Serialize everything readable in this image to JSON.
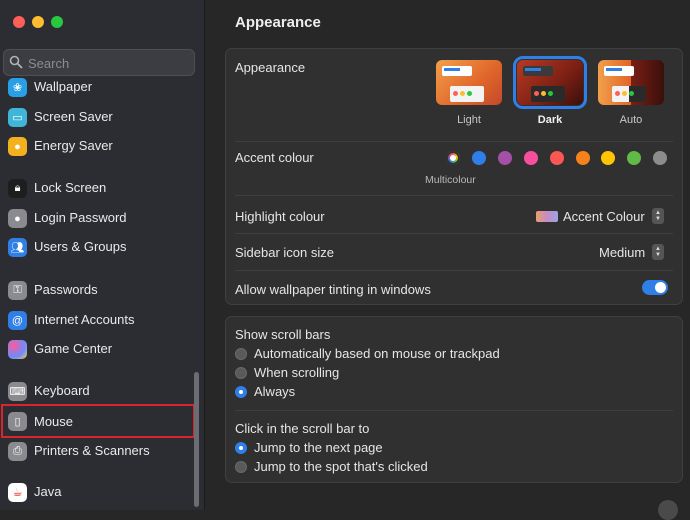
{
  "sidebar": {
    "search_placeholder": "Search",
    "items": [
      {
        "label": "Wallpaper",
        "icon": "wallpaper-icon",
        "color": "#29a0e6"
      },
      {
        "label": "Screen Saver",
        "icon": "screen-saver-icon",
        "color": "#3fb6d8"
      },
      {
        "label": "Energy Saver",
        "icon": "energy-saver-icon",
        "color": "#f2b11d"
      },
      {
        "label": "Lock Screen",
        "icon": "lock-screen-icon",
        "color": "#1e1e1e"
      },
      {
        "label": "Login Password",
        "icon": "login-password-icon",
        "color": "#8a8a8f"
      },
      {
        "label": "Users & Groups",
        "icon": "users-groups-icon",
        "color": "#2f7fe6"
      },
      {
        "label": "Passwords",
        "icon": "passwords-icon",
        "color": "#8a8a8f"
      },
      {
        "label": "Internet Accounts",
        "icon": "internet-accounts-icon",
        "color": "#2f7fe6"
      },
      {
        "label": "Game Center",
        "icon": "game-center-icon",
        "color": "#ffffff"
      },
      {
        "label": "Keyboard",
        "icon": "keyboard-icon",
        "color": "#8a8a8f"
      },
      {
        "label": "Mouse",
        "icon": "mouse-icon",
        "color": "#8a8a8f"
      },
      {
        "label": "Printers & Scanners",
        "icon": "printers-scanners-icon",
        "color": "#8a8a8f"
      },
      {
        "label": "Java",
        "icon": "java-icon",
        "color": "#ffffff"
      }
    ],
    "selected": "Mouse"
  },
  "main": {
    "title": "Appearance",
    "appearance": {
      "label": "Appearance",
      "options": [
        {
          "label": "Light",
          "selected": false
        },
        {
          "label": "Dark",
          "selected": true
        },
        {
          "label": "Auto",
          "selected": false
        }
      ]
    },
    "accent": {
      "label": "Accent colour",
      "caption": "Multicolour",
      "colors": [
        "multicolour",
        "#2f7fe6",
        "#a550a7",
        "#f74f9e",
        "#fc5753",
        "#f7821b",
        "#ffc600",
        "#62ba46",
        "#8c8c8c"
      ]
    },
    "highlight": {
      "label": "Highlight colour",
      "value": "Accent Colour"
    },
    "sidebar_icon_size": {
      "label": "Sidebar icon size",
      "value": "Medium"
    },
    "wallpaper_tinting": {
      "label": "Allow wallpaper tinting in windows",
      "enabled": true
    },
    "scroll_bars": {
      "label": "Show scroll bars",
      "options": [
        {
          "label": "Automatically based on mouse or trackpad",
          "selected": false
        },
        {
          "label": "When scrolling",
          "selected": false
        },
        {
          "label": "Always",
          "selected": true
        }
      ]
    },
    "click_scroll": {
      "label": "Click in the scroll bar to",
      "options": [
        {
          "label": "Jump to the next page",
          "selected": true
        },
        {
          "label": "Jump to the spot that's clicked",
          "selected": false
        }
      ]
    }
  },
  "colors": {
    "accent": "#2f7fe6",
    "highlight_box": "#d8262c"
  }
}
